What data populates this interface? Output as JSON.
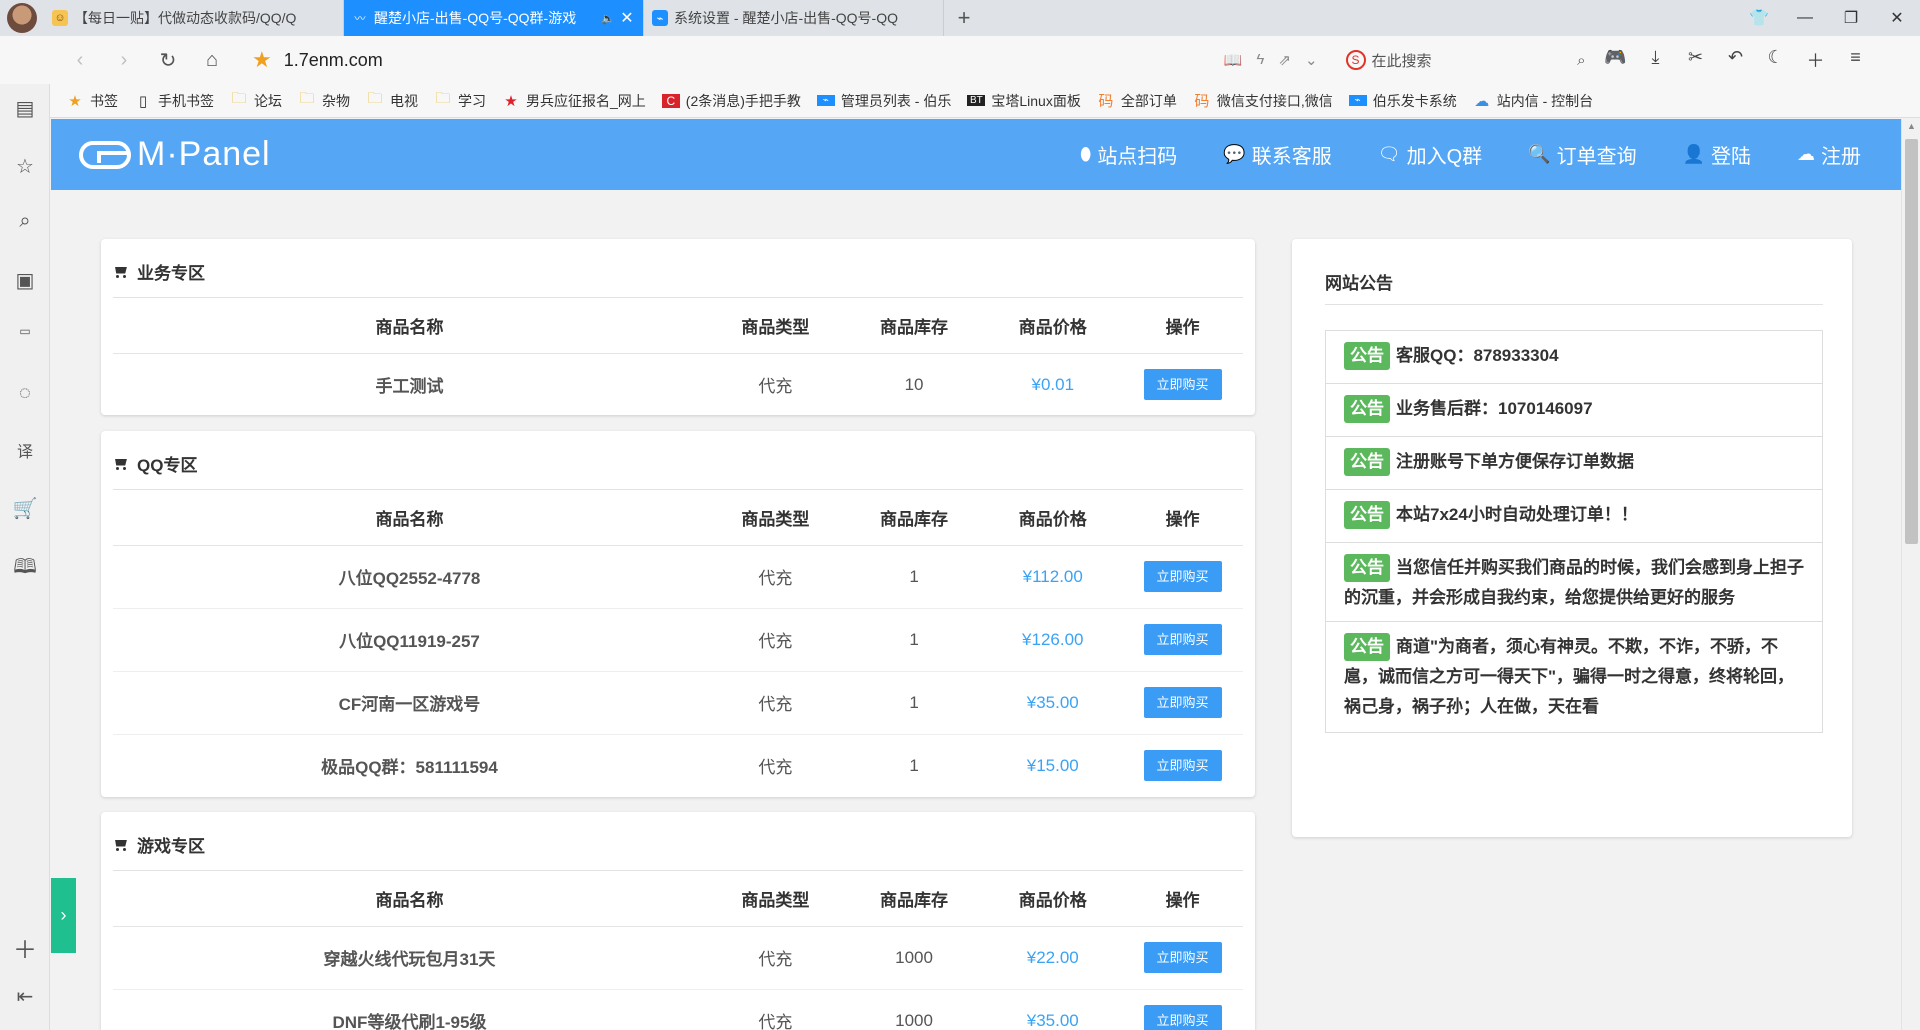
{
  "browser": {
    "tabs": [
      {
        "title": "【每日一贴】代做动态收款码/QQ/Q",
        "active": false
      },
      {
        "title": "醒楚小店-出售-QQ号-QQ群-游戏",
        "active": true
      },
      {
        "title": "系统设置 - 醒楚小店-出售-QQ号-QQ",
        "active": false
      }
    ],
    "url": "1.7enm.com",
    "search_placeholder": "在此搜索",
    "bookmarks": [
      {
        "label": "书签",
        "icon": "star-icon"
      },
      {
        "label": "手机书签",
        "icon": "phone-icon"
      },
      {
        "label": "论坛",
        "icon": "folder-icon"
      },
      {
        "label": "杂物",
        "icon": "folder-icon"
      },
      {
        "label": "电视",
        "icon": "folder-icon"
      },
      {
        "label": "学习",
        "icon": "folder-icon"
      },
      {
        "label": "男兵应征报名_网上",
        "icon": "red-star-icon"
      },
      {
        "label": "(2条消息)手把手教",
        "icon": "csdn-icon"
      },
      {
        "label": "管理员列表 - 伯乐",
        "icon": "blue-page-icon"
      },
      {
        "label": "宝塔Linux面板",
        "icon": "bt-icon"
      },
      {
        "label": "全部订单",
        "icon": "orange-icon"
      },
      {
        "label": "微信支付接口,微信",
        "icon": "orange-icon"
      },
      {
        "label": "伯乐发卡系统",
        "icon": "blue-page-icon"
      },
      {
        "label": "站内信 - 控制台",
        "icon": "cloud-icon"
      }
    ]
  },
  "site": {
    "logo": "M·Panel",
    "nav": [
      {
        "label": "站点扫码",
        "icon": "circle-icon"
      },
      {
        "label": "联系客服",
        "icon": "chat-icon"
      },
      {
        "label": "加入Q群",
        "icon": "comments-icon"
      },
      {
        "label": "订单查询",
        "icon": "search-icon"
      },
      {
        "label": "登陆",
        "icon": "user-icon"
      },
      {
        "label": "注册",
        "icon": "cloud-upload-icon"
      }
    ],
    "table_headers": [
      "商品名称",
      "商品类型",
      "商品库存",
      "商品价格",
      "操作"
    ],
    "buy_label": "立即购买",
    "sections": [
      {
        "title": "业务专区",
        "rows": [
          {
            "name": "手工测试",
            "type": "代充",
            "stock": "10",
            "price": "¥0.01"
          }
        ]
      },
      {
        "title": "QQ专区",
        "rows": [
          {
            "name": "八位QQ2552-4778",
            "type": "代充",
            "stock": "1",
            "price": "¥112.00"
          },
          {
            "name": "八位QQ11919-257",
            "type": "代充",
            "stock": "1",
            "price": "¥126.00"
          },
          {
            "name": "CF河南一区游戏号",
            "type": "代充",
            "stock": "1",
            "price": "¥35.00"
          },
          {
            "name": "极品QQ群：581111594",
            "type": "代充",
            "stock": "1",
            "price": "¥15.00"
          }
        ]
      },
      {
        "title": "游戏专区",
        "rows": [
          {
            "name": "穿越火线代玩包月31天",
            "type": "代充",
            "stock": "1000",
            "price": "¥22.00"
          },
          {
            "name": "DNF等级代刷1-95级",
            "type": "代充",
            "stock": "1000",
            "price": "¥35.00"
          }
        ]
      }
    ],
    "notice_title": "网站公告",
    "notice_badge": "公告",
    "notices": [
      "客服QQ：878933304",
      "业务售后群：1070146097",
      "注册账号下单方便保存订单数据",
      "本站7x24小时自动处理订单！！",
      "当您信任并购买我们商品的时候，我们会感到身上担子的沉重，并会形成自我约束，给您提供给更好的服务",
      "商道\"为商者，须心有神灵。不欺，不诈，不骄，不扈，诚而信之方可一得天下\"，骗得一时之得意，终将轮回，祸己身，祸子孙；人在做，天在看"
    ]
  },
  "colors": {
    "navbar": "#55a7f6",
    "active_tab": "#1e8fff",
    "buy_button": "#3a9cf5",
    "price": "#3aa3f5",
    "badge": "#5cb85c",
    "side_toggle": "#1fbf8f"
  }
}
